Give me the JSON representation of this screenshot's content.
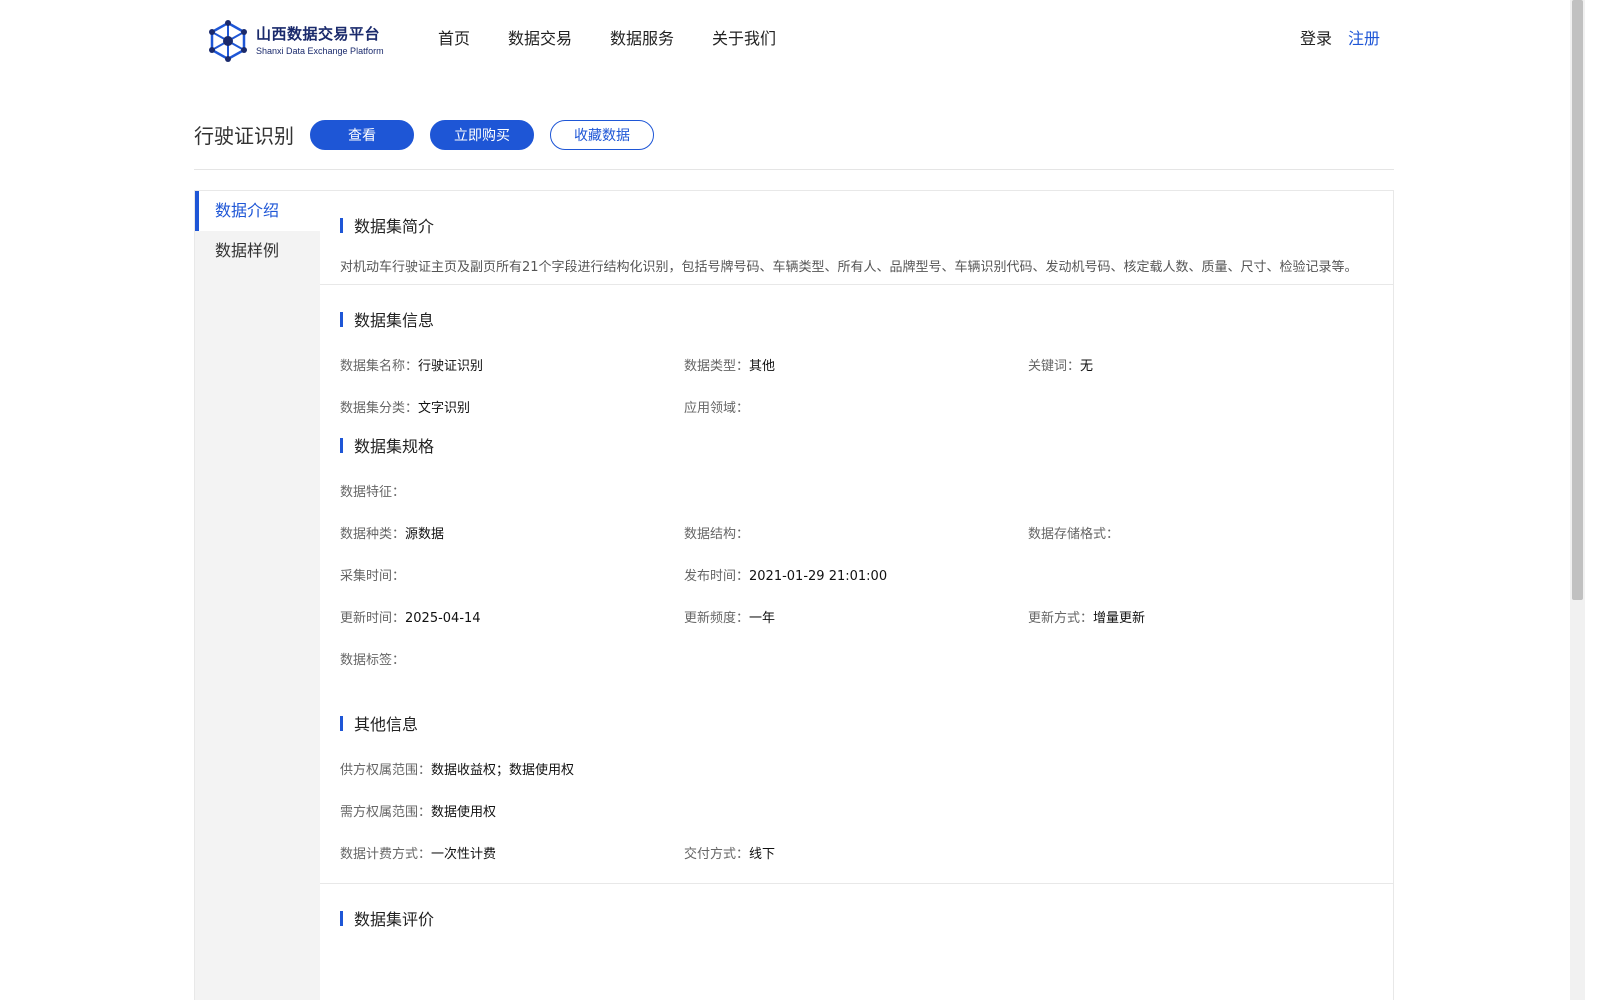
{
  "header": {
    "logo_cn": "山西数据交易平台",
    "logo_en": "Shanxi Data Exchange Platform",
    "nav": [
      "首页",
      "数据交易",
      "数据服务",
      "关于我们"
    ],
    "login": "登录",
    "register": "注册"
  },
  "title": "行驶证识别",
  "actions": {
    "view": "查看",
    "buy": "立即购买",
    "favorite": "收藏数据"
  },
  "sidebar": {
    "items": [
      {
        "label": "数据介绍"
      },
      {
        "label": "数据样例"
      }
    ]
  },
  "intro": {
    "title": "数据集简介",
    "text": "对机动车行驶证主页及副页所有21个字段进行结构化识别，包括号牌号码、车辆类型、所有人、品牌型号、车辆识别代码、发动机号码、核定载人数、质量、尺寸、检验记录等。"
  },
  "info": {
    "title": "数据集信息",
    "name_k": "数据集名称：",
    "name_v": "行驶证识别",
    "type_k": "数据类型：",
    "type_v": "其他",
    "kw_k": "关键词：",
    "kw_v": "无",
    "cat_k": "数据集分类：",
    "cat_v": "文字识别",
    "domain_k": "应用领域：",
    "domain_v": ""
  },
  "spec": {
    "title": "数据集规格",
    "feature_k": "数据特征：",
    "feature_v": "",
    "kind_k": "数据种类：",
    "kind_v": "源数据",
    "struct_k": "数据结构：",
    "struct_v": "",
    "store_k": "数据存储格式：",
    "store_v": "",
    "collect_k": "采集时间：",
    "collect_v": "",
    "publish_k": "发布时间：",
    "publish_v": "2021-01-29 21:01:00",
    "update_k": "更新时间：",
    "update_v": "2025-04-14",
    "freq_k": "更新频度：",
    "freq_v": "一年",
    "mode_k": "更新方式：",
    "mode_v": "增量更新",
    "tag_k": "数据标签：",
    "tag_v": ""
  },
  "other": {
    "title": "其他信息",
    "supply_k": "供方权属范围：",
    "supply_v": "数据收益权；数据使用权",
    "demand_k": "需方权属范围：",
    "demand_v": "数据使用权",
    "billing_k": "数据计费方式：",
    "billing_v": "一次性计费",
    "delivery_k": "交付方式：",
    "delivery_v": "线下"
  },
  "review": {
    "title": "数据集评价"
  },
  "colors": {
    "accent": "#1e56d6",
    "sidebar_bg": "#f3f3f3",
    "logo": "#1a2a6c"
  }
}
